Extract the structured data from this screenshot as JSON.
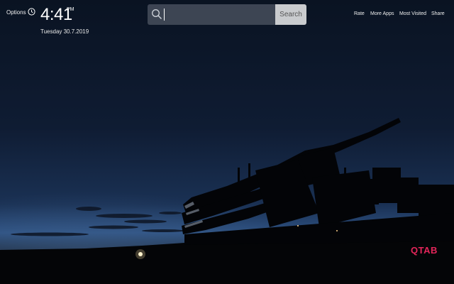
{
  "header": {
    "options_label": "Options",
    "time": "4:41",
    "ampm": "PM",
    "date": "Tuesday 30.7.2019"
  },
  "search": {
    "placeholder": "",
    "value": "",
    "button_label": "Search"
  },
  "nav": {
    "rate": "Rate",
    "more_apps": "More Apps",
    "most_visited": "Most Visited",
    "share": "Share"
  },
  "brand": {
    "logo_text": "QTAB",
    "logo_color": "#e4255a"
  },
  "icons": {
    "clock": "clock-icon",
    "search": "search-icon"
  },
  "background": {
    "scene": "rocket-on-launch-pad-at-dusk",
    "sky_top": "#0b1425",
    "sky_horizon": "#2b4c78"
  }
}
